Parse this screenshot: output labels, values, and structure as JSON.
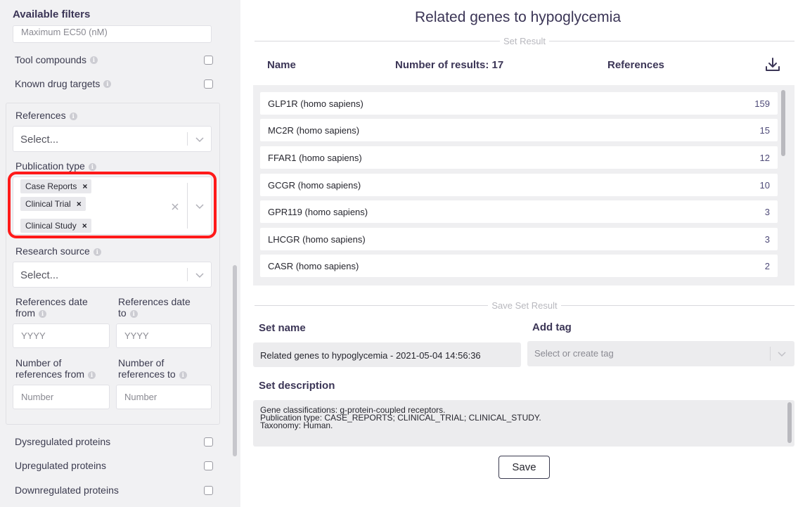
{
  "sidebar": {
    "title": "Available filters",
    "top_input_placeholder": "Maximum EC50 (nM)",
    "checkbox_filters_top": [
      {
        "label": "Tool compounds",
        "checked": false
      },
      {
        "label": "Known drug targets",
        "checked": false
      }
    ],
    "references_group": {
      "references_label": "References",
      "references_placeholder": "Select...",
      "publication_type_label": "Publication type",
      "publication_tags": [
        "Case Reports",
        "Clinical Trial",
        "Clinical Study"
      ],
      "research_source_label": "Research source",
      "research_source_placeholder": "Select...",
      "date_from_label_1": "References date",
      "date_from_label_2": "from",
      "date_to_label_1": "References date",
      "date_to_label_2": "to",
      "date_from_placeholder": "YYYY",
      "date_to_placeholder": "YYYY",
      "num_from_label_1": "Number of",
      "num_from_label_2": "references from",
      "num_to_label_1": "Number of",
      "num_to_label_2": "references to",
      "num_from_placeholder": "Number",
      "num_to_placeholder": "Number"
    },
    "checkbox_filters_bottom": [
      {
        "label": "Dysregulated proteins",
        "checked": false
      },
      {
        "label": "Upregulated proteins",
        "checked": false
      },
      {
        "label": "Downregulated proteins",
        "checked": false
      }
    ]
  },
  "main": {
    "title": "Related genes to hypoglycemia",
    "set_result_label": "Set Result",
    "columns": {
      "name": "Name",
      "count": "Number of results: 17",
      "references": "References"
    },
    "results": [
      {
        "name": "GLP1R (homo sapiens)",
        "references": "159"
      },
      {
        "name": "MC2R (homo sapiens)",
        "references": "15"
      },
      {
        "name": "FFAR1 (homo sapiens)",
        "references": "12"
      },
      {
        "name": "GCGR (homo sapiens)",
        "references": "10"
      },
      {
        "name": "GPR119 (homo sapiens)",
        "references": "3"
      },
      {
        "name": "LHCGR (homo sapiens)",
        "references": "3"
      },
      {
        "name": "CASR (homo sapiens)",
        "references": "2"
      }
    ],
    "save_section": {
      "label": "Save Set Result",
      "set_name_label": "Set name",
      "set_name_value": "Related genes to hypoglycemia - 2021-05-04 14:56:36",
      "add_tag_label": "Add tag",
      "tag_placeholder": "Select or create tag",
      "description_label": "Set description",
      "description_lines": [
        "Gene classifications: g-protein-coupled receptors.",
        "Publication type: CASE_REPORTS; CLINICAL_TRIAL; CLINICAL_STUDY.",
        "Taxonomy: Human."
      ],
      "save_button": "Save"
    }
  },
  "icons": {
    "info": "info-icon",
    "download": "download-icon",
    "chevron": "chevron-down-icon",
    "clear": "close-icon"
  },
  "colors": {
    "highlight": "#ff1a1a",
    "heading": "#3b3556",
    "sidebar_bg": "#f1f1f3"
  }
}
